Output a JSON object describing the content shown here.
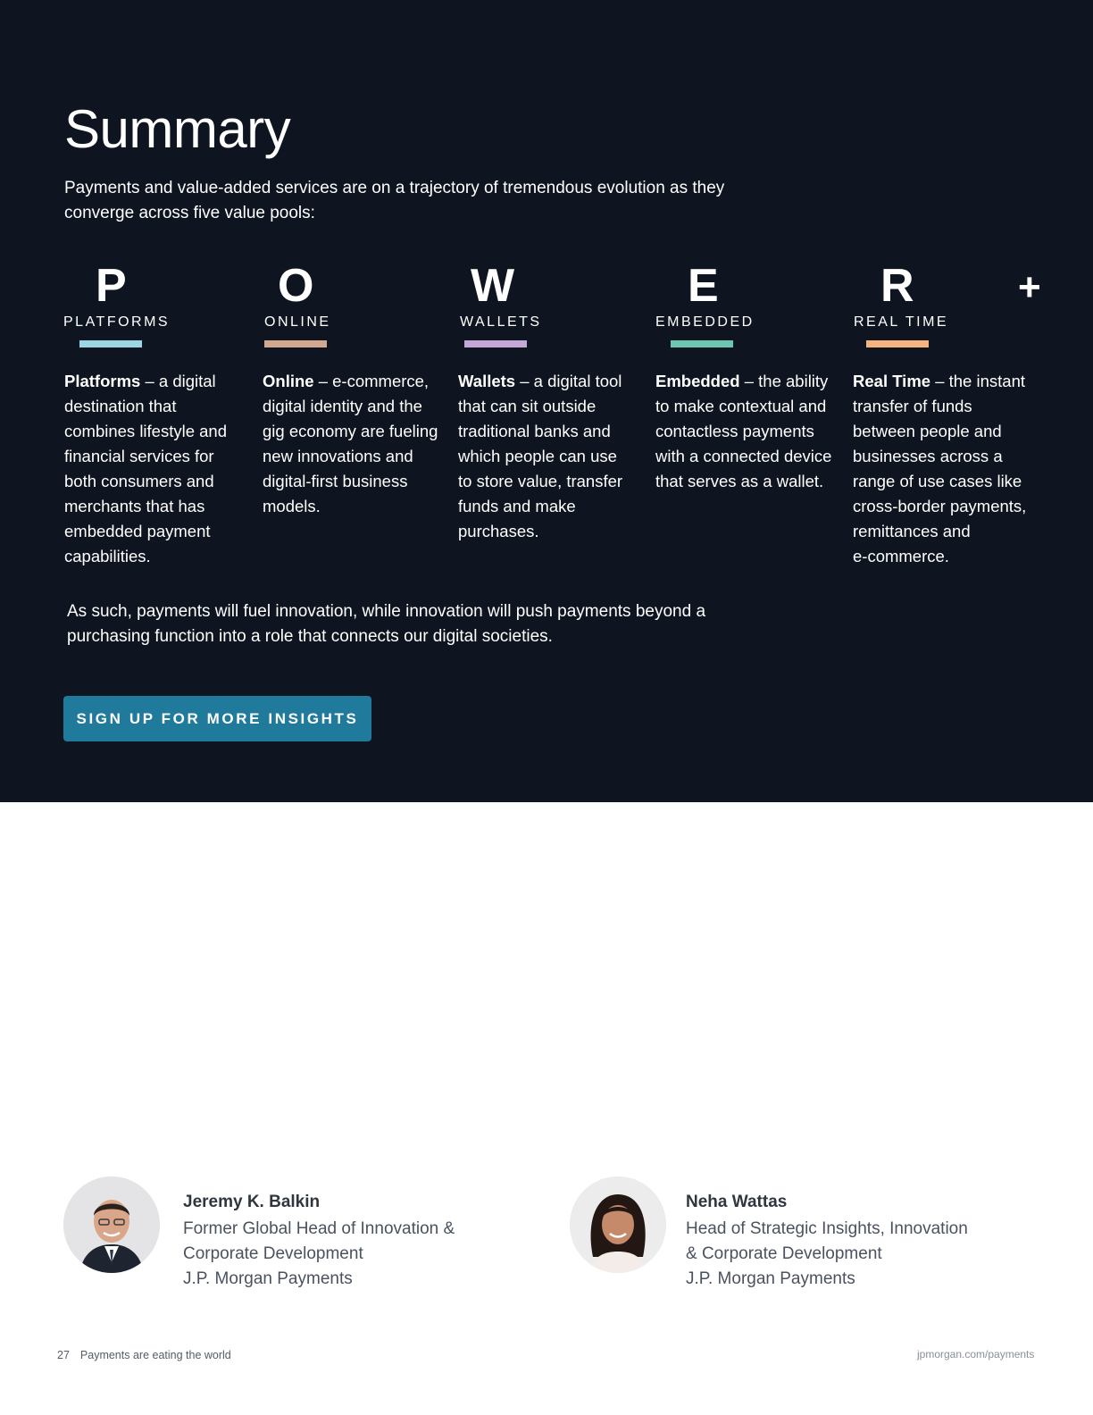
{
  "summary": {
    "title": "Summary",
    "intro_line1": "Payments and value-added services are on a trajectory of tremendous evolution as they",
    "intro_line2": "converge across five value pools:"
  },
  "pillars": [
    {
      "letter": "P",
      "label": "PLATFORMS",
      "color": "#9bd6e4",
      "lead": "Platforms",
      "lines": [
        " – a digital",
        "destination that",
        "combines lifestyle and",
        "financial services for",
        "both consumers and",
        "merchants that has",
        "embedded payment",
        "capabilities."
      ]
    },
    {
      "letter": "O",
      "label": "ONLINE",
      "color": "#d2a98f",
      "lead": "Online",
      "lines": [
        " – e-commerce,",
        "digital identity and the",
        "gig economy are fueling",
        "new innovations and",
        "digital-first business",
        "models."
      ]
    },
    {
      "letter": "W",
      "label": "WALLETS",
      "color": "#c6a8d8",
      "lead": "Wallets",
      "lines": [
        " – a digital tool",
        "that can sit outside",
        "traditional banks and",
        "which people can use",
        "to store value, transfer",
        "funds and make",
        "purchases."
      ]
    },
    {
      "letter": "E",
      "label": "EMBEDDED",
      "color": "#6cc6b0",
      "lead": "Embedded",
      "lines": [
        " – the ability",
        "to make contextual and",
        "contactless payments",
        "with a connected device",
        "that serves as a wallet."
      ]
    },
    {
      "letter": "R",
      "label": "REAL TIME",
      "color": "#f5b47e",
      "lead": "Real Time",
      "lines": [
        " – the instant",
        "transfer of funds",
        "between people and",
        "businesses across a",
        "range of use cases like",
        "cross-border payments,",
        "remittances and",
        "e-commerce."
      ]
    }
  ],
  "plus_sign": "+",
  "closing_line1": "As such, payments will fuel innovation, while innovation will push payments beyond a",
  "closing_line2": "purchasing function into a role that connects our digital societies.",
  "cta_label": "SIGN UP FOR MORE INSIGHTS",
  "people": [
    {
      "name": "Jeremy K. Balkin",
      "line1": "Former Global Head of Innovation &",
      "line2": "Corporate Development",
      "line3": "J.P. Morgan Payments"
    },
    {
      "name": "Neha Wattas",
      "line1": "Head of Strategic Insights, Innovation",
      "line2": "& Corporate Development",
      "line3": "J.P. Morgan Payments"
    }
  ],
  "footer": {
    "page_number": "27",
    "publication": "Payments are eating the world",
    "url": "jpmorgan.com/payments"
  }
}
